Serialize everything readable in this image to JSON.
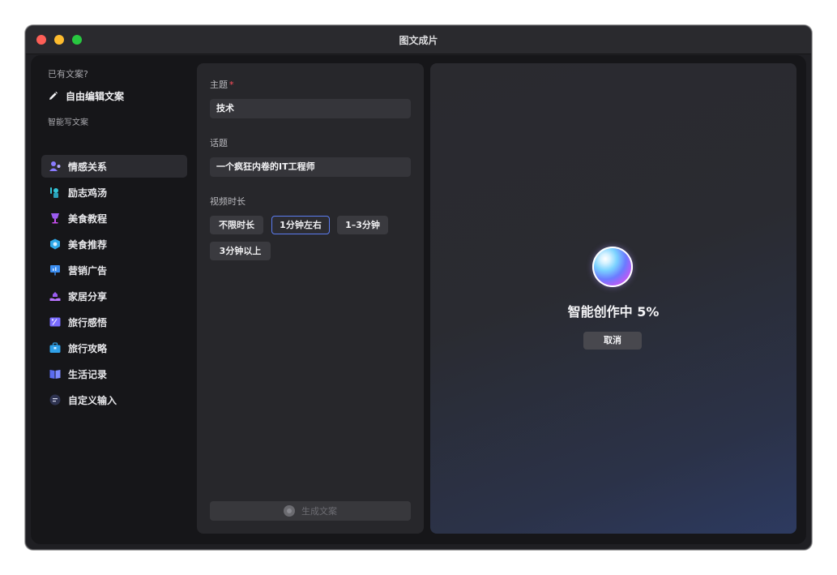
{
  "window": {
    "title": "图文成片"
  },
  "sidebar": {
    "existing_label": "已有文案?",
    "free_edit_label": "自由编辑文案",
    "smart_label": "智能写文案",
    "items": [
      {
        "label": "情感关系",
        "icon": "person-heart-icon",
        "color": "#8a7bff",
        "active": true
      },
      {
        "label": "励志鸡汤",
        "icon": "cheer-person-icon",
        "color": "#33c4d8"
      },
      {
        "label": "美食教程",
        "icon": "wine-glass-icon",
        "color": "#9b5cf0"
      },
      {
        "label": "美食推荐",
        "icon": "food-badge-icon",
        "color": "#2fa8e8"
      },
      {
        "label": "营销广告",
        "icon": "presentation-board-icon",
        "color": "#3b8df0"
      },
      {
        "label": "家居分享",
        "icon": "hand-home-icon",
        "color": "#9a5cf0"
      },
      {
        "label": "旅行感悟",
        "icon": "ticket-icon",
        "color": "#7a6cff"
      },
      {
        "label": "旅行攻略",
        "icon": "suitcase-icon",
        "color": "#2fa0e8"
      },
      {
        "label": "生活记录",
        "icon": "book-icon",
        "color": "#5b6cf0"
      },
      {
        "label": "自定义输入",
        "icon": "note-icon",
        "color": "#2e3350"
      }
    ]
  },
  "form": {
    "topic_label": "主题",
    "topic_required": "*",
    "topic_value": "技术",
    "subject_label": "话题",
    "subject_value": "一个疯狂内卷的IT工程师",
    "duration_label": "视频时长",
    "durations": [
      "不限时长",
      "1分钟左右",
      "1–3分钟",
      "3分钟以上"
    ],
    "selected_duration": "1分钟左右",
    "generate_label": "生成文案"
  },
  "preview": {
    "progress_text": "智能创作中 5%",
    "progress_percent": 5,
    "cancel_label": "取消"
  },
  "colors": {
    "accent": "#5b7cf0",
    "required": "#ff4d5a"
  }
}
